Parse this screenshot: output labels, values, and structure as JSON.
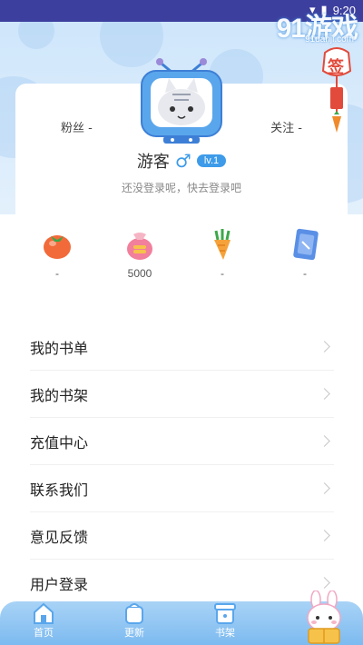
{
  "status_bar": {
    "time": "9:20"
  },
  "watermark": {
    "text": "91游戏",
    "sub": "91danji.com"
  },
  "profile": {
    "fans_label": "粉丝 -",
    "follow_label": "关注 -",
    "username": "游客",
    "gender_symbol": "♂",
    "level": "lv.1",
    "login_hint": "还没登录呢，快去登录吧"
  },
  "signin": {
    "label": "签"
  },
  "stats": [
    {
      "icon": "tomato-icon",
      "value": "-"
    },
    {
      "icon": "coin-bag-icon",
      "value": "5000"
    },
    {
      "icon": "carrot-icon",
      "value": "-"
    },
    {
      "icon": "card-icon",
      "value": "-"
    }
  ],
  "menu": [
    {
      "label": "我的书单"
    },
    {
      "label": "我的书架"
    },
    {
      "label": "充值中心"
    },
    {
      "label": "联系我们"
    },
    {
      "label": "意见反馈"
    },
    {
      "label": "用户登录"
    }
  ],
  "bottom_nav": [
    {
      "label": "首页",
      "icon": "home-icon"
    },
    {
      "label": "更新",
      "icon": "update-icon"
    },
    {
      "label": "书架",
      "icon": "bookshelf-icon"
    }
  ],
  "colors": {
    "accent": "#3d9be9",
    "status_bar": "#3d3f9e",
    "nav": "#7cbaf0"
  }
}
